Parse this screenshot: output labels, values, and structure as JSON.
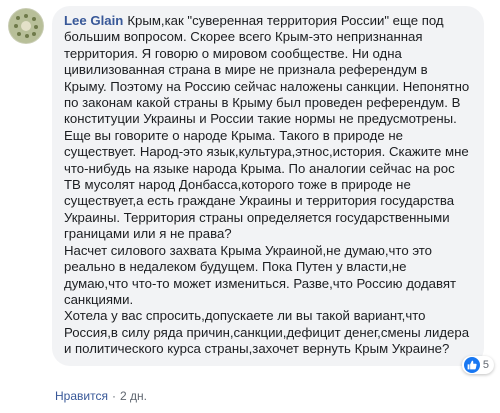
{
  "comment": {
    "author": "Lee Glain",
    "text": "Крым,как \"суверенная территория России\" еще под большим вопросом. Скорее всего Крым-это непризнанная территория. Я говорю о мировом сообществе. Ни одна цивилизованная страна в мире не признала референдум в Крыму. Поэтому на Россию сейчас наложены санкции. Непонятно по законам какой страны в Крыму был проведен референдум. В конституции Украины и России такие нормы не предусмотрены.\nЕще вы говорите о народе Крыма. Такого в природе не существует. Народ-это язык,культура,этнос,история. Скажите мне что-нибудь на языке народа Крыма. По аналогии сейчас на рос ТВ мусолят народ Донбасса,которого тоже в природе не существует,а есть граждане Украины и территория государства Украины. Территория страны определяется государственными границами или я не права?\nНасчет силового захвата Крыма Украиной,не думаю,что это реально в недалеком будущем. Пока Путен у власти,не думаю,что что-то может измениться. Разве,что Россию додавят санкциями.\nХотела у вас спросить,допускаете ли вы такой вариант,что Россия,в силу ряда причин,санкции,дефицит денег,смены лидера и политического курса страны,захочет вернуть Крым Украине?",
    "reaction_count": "5",
    "reaction_icon": "like-icon"
  },
  "actions": {
    "like_label": "Нравится",
    "separator": "·",
    "time": "2 дн."
  },
  "colors": {
    "author": "#385898",
    "bubble_bg": "#f2f3f5",
    "text": "#1c1e21",
    "meta": "#606770",
    "like_blue": "#1877f2"
  }
}
